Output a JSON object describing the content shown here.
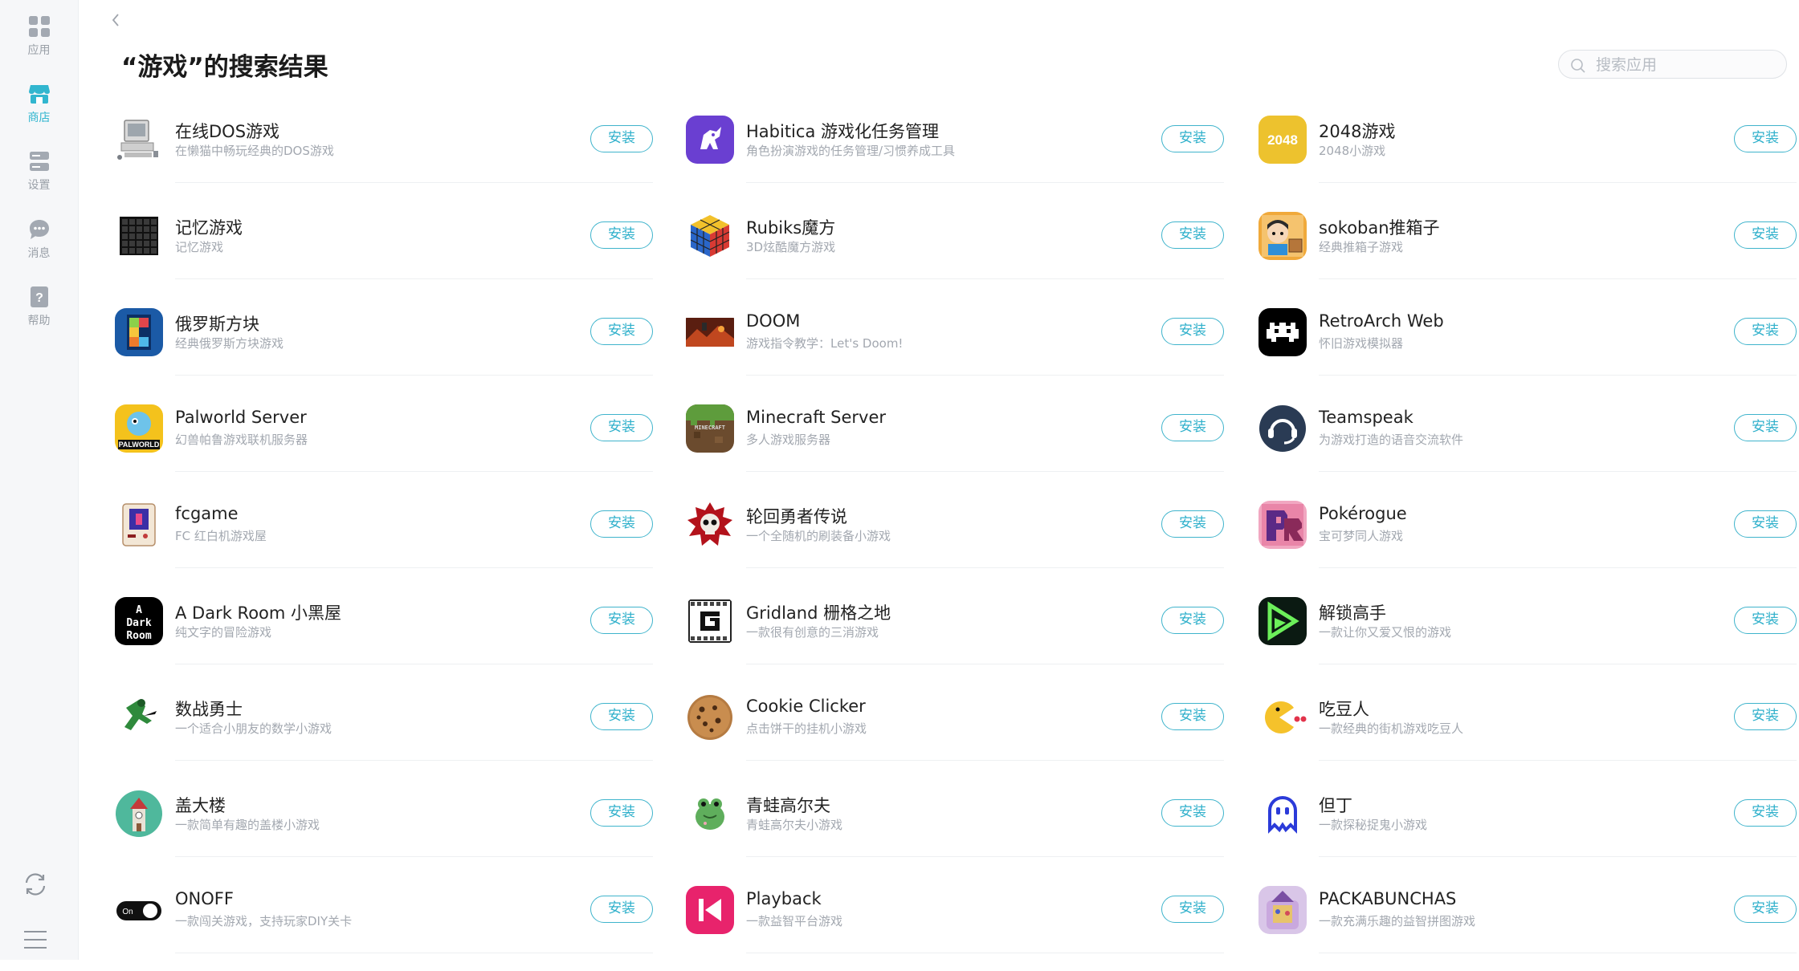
{
  "sidebar": {
    "items": [
      {
        "label": "应用",
        "icon": "apps-grid-icon"
      },
      {
        "label": "商店",
        "icon": "store-icon",
        "active": true
      },
      {
        "label": "设置",
        "icon": "settings-icon"
      },
      {
        "label": "消息",
        "icon": "message-icon"
      },
      {
        "label": "帮助",
        "icon": "help-icon"
      }
    ],
    "bottom_icons": [
      "refresh-icon",
      "menu-icon"
    ]
  },
  "header": {
    "back_icon": "chevron-left-icon",
    "title": "“游戏”的搜索结果",
    "search_placeholder": "搜索应用"
  },
  "install_label": "安装",
  "colors": {
    "accent": "#31b6cf"
  },
  "columns": [
    [
      {
        "name": "在线DOS游戏",
        "desc": "在懒猫中畅玩经典的DOS游戏",
        "icon": "retro-computer-icon"
      },
      {
        "name": "记忆游戏",
        "desc": "记忆游戏",
        "icon": "memory-grid-icon"
      },
      {
        "name": "俄罗斯方块",
        "desc": "经典俄罗斯方块游戏",
        "icon": "tetris-icon"
      },
      {
        "name": "Palworld Server",
        "desc": "幻兽帕鲁游戏联机服务器",
        "icon": "palworld-icon"
      },
      {
        "name": "fcgame",
        "desc": "FC 红白机游戏屋",
        "icon": "famicom-icon"
      },
      {
        "name": "A Dark Room 小黑屋",
        "desc": "纯文字的冒险游戏",
        "icon": "dark-room-icon"
      },
      {
        "name": "数战勇士",
        "desc": "一个适合小朋友的数学小游戏",
        "icon": "ninja-icon"
      },
      {
        "name": "盖大楼",
        "desc": "一款简单有趣的盖楼小游戏",
        "icon": "tower-icon"
      },
      {
        "name": "ONOFF",
        "desc": "一款闯关游戏，支持玩家DIY关卡",
        "icon": "onoff-toggle-icon"
      }
    ],
    [
      {
        "name": "Habitica 游戏化任务管理",
        "desc": "角色扮演游戏的任务管理/习惯养成工具",
        "icon": "habitica-icon"
      },
      {
        "name": "Rubiks魔方",
        "desc": "3D炫酷魔方游戏",
        "icon": "rubiks-cube-icon"
      },
      {
        "name": "DOOM",
        "desc": "游戏指令教学：Let's Doom!",
        "icon": "doom-icon"
      },
      {
        "name": "Minecraft Server",
        "desc": "多人游戏服务器",
        "icon": "minecraft-icon"
      },
      {
        "name": "轮回勇者传说",
        "desc": "一个全随机的刷装备小游戏",
        "icon": "skull-icon"
      },
      {
        "name": "Gridland 栅格之地",
        "desc": "一款很有创意的三消游戏",
        "icon": "gridland-icon"
      },
      {
        "name": "Cookie Clicker",
        "desc": "点击饼干的挂机小游戏",
        "icon": "cookie-icon"
      },
      {
        "name": "青蛙高尔夫",
        "desc": "青蛙高尔夫小游戏",
        "icon": "frog-icon"
      },
      {
        "name": "Playback",
        "desc": "一款益智平台游戏",
        "icon": "playback-icon"
      }
    ],
    [
      {
        "name": "2048游戏",
        "desc": "2048小游戏",
        "icon": "2048-icon",
        "icon_text": "2048"
      },
      {
        "name": "sokoban推箱子",
        "desc": "经典推箱子游戏",
        "icon": "sokoban-icon"
      },
      {
        "name": "RetroArch Web",
        "desc": "怀旧游戏模拟器",
        "icon": "retroarch-icon"
      },
      {
        "name": "Teamspeak",
        "desc": "为游戏打造的语音交流软件",
        "icon": "teamspeak-icon"
      },
      {
        "name": "Pokérogue",
        "desc": "宝可梦同人游戏",
        "icon": "pokerogue-icon"
      },
      {
        "name": "解锁高手",
        "desc": "一款让你又爱又恨的游戏",
        "icon": "unlock-master-icon"
      },
      {
        "name": "吃豆人",
        "desc": "一款经典的街机游戏吃豆人",
        "icon": "pacman-icon"
      },
      {
        "name": "但丁",
        "desc": "一款探秘捉鬼小游戏",
        "icon": "ghost-icon"
      },
      {
        "name": "PACKABUNCHAS",
        "desc": "一款充满乐趣的益智拼图游戏",
        "icon": "packabunchas-icon"
      }
    ]
  ]
}
